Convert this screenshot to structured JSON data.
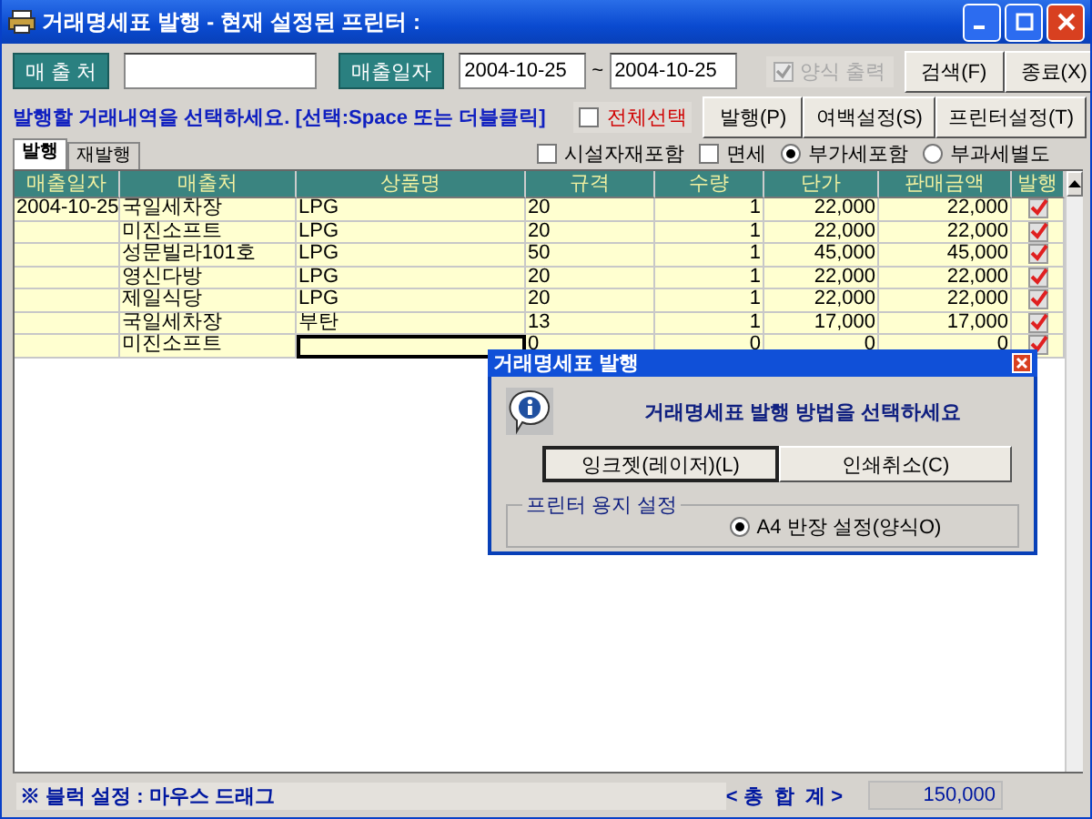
{
  "window": {
    "title": "거래명세표 발행 - 현재 설정된 프린터 :"
  },
  "filters": {
    "customer_label": "매 출 처",
    "date_label": "매출일자",
    "date_from": "2004-10-25",
    "date_separator": "~",
    "date_to": "2004-10-25",
    "form_print": {
      "label": "양식 출력",
      "checked": true,
      "disabled": true
    }
  },
  "top_buttons": [
    "검색(F)",
    "종료(X)"
  ],
  "instruction": "발행할 거래내역을 선택하세요. [선택:Space 또는 더블클릭]",
  "select_all": {
    "label": "전체선택",
    "checked": false
  },
  "action_buttons": [
    "발행(P)",
    "여백설정(S)",
    "프린터설정(T)"
  ],
  "tabs": [
    {
      "label": "발행",
      "selected": true
    },
    {
      "label": "재발행",
      "selected": false
    }
  ],
  "options": [
    {
      "kind": "checkbox",
      "label": "시설자재포함",
      "checked": false
    },
    {
      "kind": "checkbox",
      "label": "면세",
      "checked": false
    },
    {
      "kind": "radio",
      "label": "부가세포함",
      "selected": true
    },
    {
      "kind": "radio",
      "label": "부과세별도",
      "selected": false
    }
  ],
  "table": {
    "columns": [
      "매출일자",
      "매출처",
      "상품명",
      "규격",
      "수량",
      "단가",
      "판매금액",
      "발행"
    ],
    "rows": [
      {
        "date": "2004-10-25",
        "customer": "국일세차장",
        "product": "LPG",
        "spec": "20",
        "qty": "1",
        "price": "22,000",
        "amount": "22,000",
        "issued": true,
        "focused": false
      },
      {
        "customer": "미진소프트",
        "product": "LPG",
        "spec": "20",
        "qty": "1",
        "price": "22,000",
        "amount": "22,000",
        "issued": true,
        "focused": false
      },
      {
        "customer": "성문빌라101호",
        "product": "LPG",
        "spec": "50",
        "qty": "1",
        "price": "45,000",
        "amount": "45,000",
        "issued": true,
        "focused": false
      },
      {
        "customer": "영신다방",
        "product": "LPG",
        "spec": "20",
        "qty": "1",
        "price": "22,000",
        "amount": "22,000",
        "issued": true,
        "focused": false
      },
      {
        "customer": "제일식당",
        "product": "LPG",
        "spec": "20",
        "qty": "1",
        "price": "22,000",
        "amount": "22,000",
        "issued": true,
        "focused": false
      },
      {
        "customer": "국일세차장",
        "product": "부탄",
        "spec": "13",
        "qty": "1",
        "price": "17,000",
        "amount": "17,000",
        "issued": true,
        "focused": false
      },
      {
        "customer": "미진소프트",
        "spec": "0",
        "qty": "0",
        "price": "0",
        "amount": "0",
        "issued": true,
        "focused": true
      }
    ]
  },
  "dialog": {
    "title": "거래명세표 발행",
    "message": "거래명세표 발행 방법을 선택하세요",
    "buttons": [
      {
        "label": "잉크젯(레이저)(L)",
        "default": true
      },
      {
        "label": "인쇄취소(C)",
        "default": false
      }
    ],
    "group_label": "프린터 용지 설정",
    "paper_option": {
      "label": "A4 반장 설정(양식O)",
      "selected": true
    }
  },
  "status_bar": {
    "hint": "※ 블럭 설정 : 마우스 드래그",
    "total_label": "< 총  합  계 >",
    "total": "150,000"
  }
}
